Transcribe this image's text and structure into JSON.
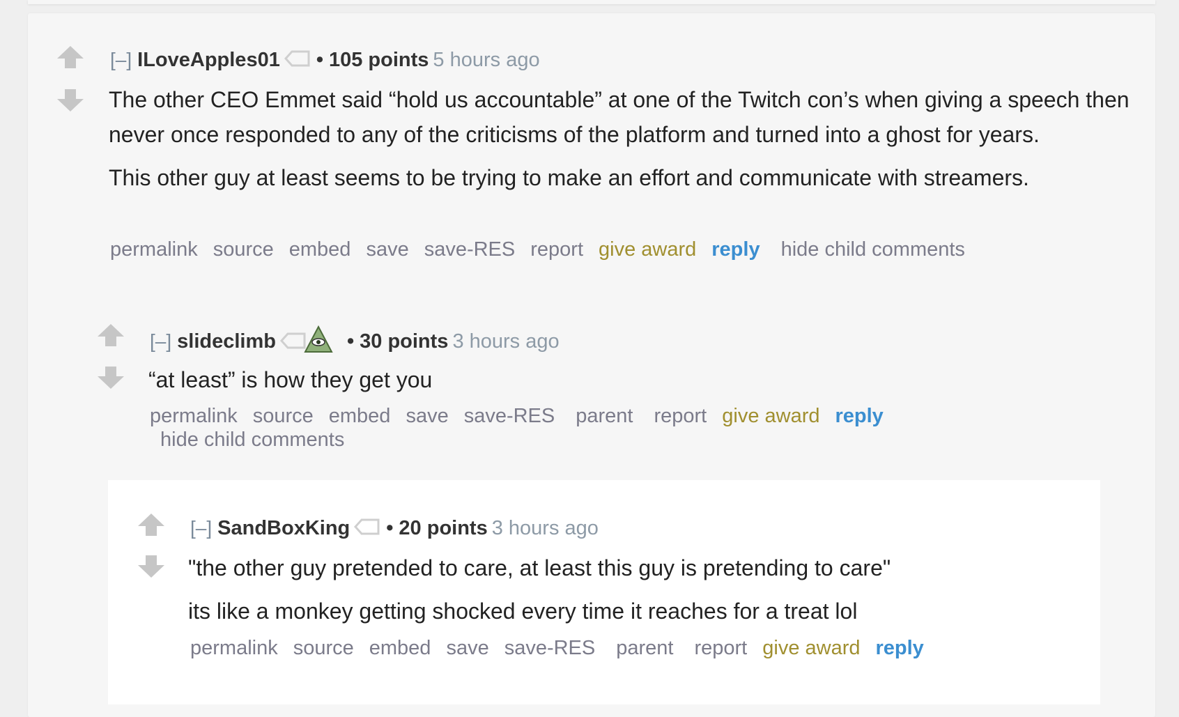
{
  "comments": [
    {
      "collapse": "[–]",
      "author": "ILoveApples01",
      "score": "105 points",
      "time": "5 hours ago",
      "paragraphs": [
        "The other CEO Emmet said “hold us accountable” at one of the Twitch con’s when giving a speech then never once responded to any of the criticisms of the platform and turned into a ghost for years.",
        "This other guy at least seems to be trying to make an effort and communicate with streamers."
      ],
      "buttons": {
        "permalink": "permalink",
        "source": "source",
        "embed": "embed",
        "save": "save",
        "save_res": "save-RES",
        "report": "report",
        "give_award": "give award",
        "reply": "reply",
        "hide_child": "hide child comments"
      }
    },
    {
      "collapse": "[–]",
      "author": "slideclimb",
      "score": "30 points",
      "time": "3 hours ago",
      "paragraphs": [
        "“at least” is how they get you"
      ],
      "buttons": {
        "permalink": "permalink",
        "source": "source",
        "embed": "embed",
        "save": "save",
        "save_res": "save-RES",
        "parent": "parent",
        "report": "report",
        "give_award": "give award",
        "reply": "reply",
        "hide_child": "hide child comments"
      }
    },
    {
      "collapse": "[–]",
      "author": "SandBoxKing",
      "score": "20 points",
      "time": "3 hours ago",
      "paragraphs": [
        "\"the other guy pretended to care, at least this guy is pretending to care\"",
        "its like a monkey getting shocked every time it reaches for a treat lol"
      ],
      "buttons": {
        "permalink": "permalink",
        "source": "source",
        "embed": "embed",
        "save": "save",
        "save_res": "save-RES",
        "parent": "parent",
        "report": "report",
        "give_award": "give award",
        "reply": "reply"
      }
    }
  ],
  "icons": {
    "upvote": "upvote-arrow-icon",
    "downvote": "downvote-arrow-icon",
    "tag": "user-tag-icon",
    "flair": "illuminati-eye-icon"
  },
  "colors": {
    "award": "#a08f2f",
    "reply": "#3b8ed0",
    "time": "#8d9aa6"
  }
}
